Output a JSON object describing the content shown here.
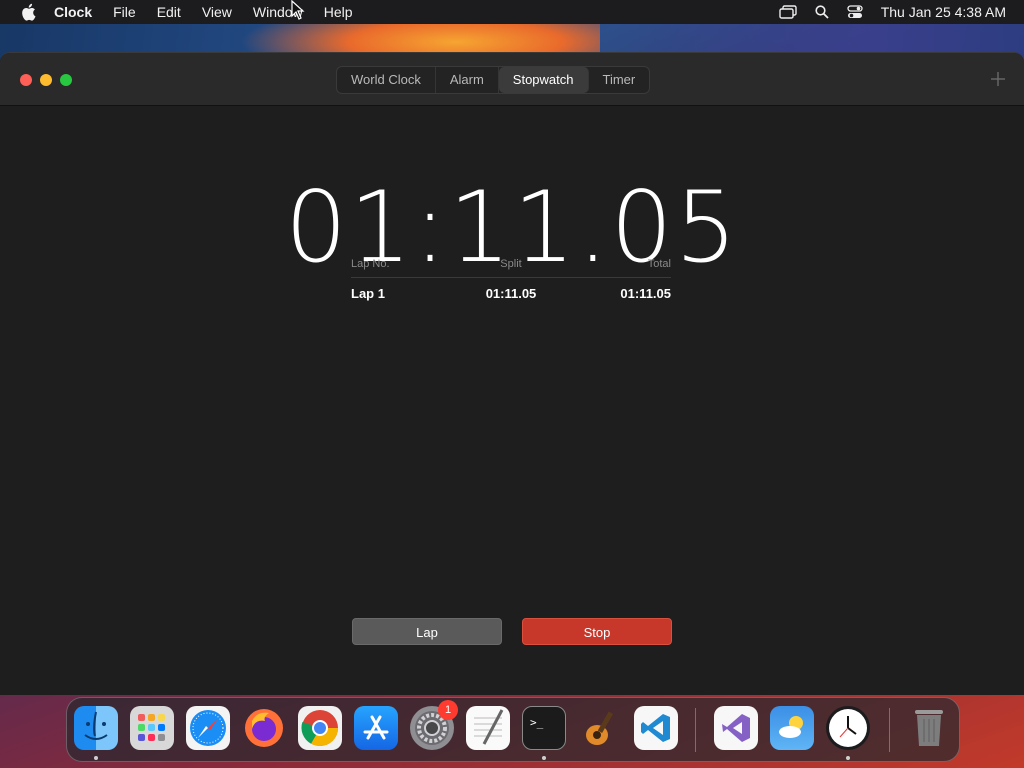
{
  "menubar": {
    "app_name": "Clock",
    "items": [
      "File",
      "Edit",
      "View",
      "Window",
      "Help"
    ],
    "datetime": "Thu Jan 25  4:38 AM"
  },
  "window": {
    "tabs": [
      {
        "label": "World Clock",
        "active": false
      },
      {
        "label": "Alarm",
        "active": false
      },
      {
        "label": "Stopwatch",
        "active": true
      },
      {
        "label": "Timer",
        "active": false
      }
    ]
  },
  "stopwatch": {
    "display": "01:11.05",
    "laps_header": {
      "lap_no": "Lap No.",
      "split": "Split",
      "total": "Total"
    },
    "laps": [
      {
        "lap": "Lap 1",
        "split": "01:11.05",
        "total": "01:11.05"
      }
    ],
    "lap_button": "Lap",
    "stop_button": "Stop"
  },
  "dock": {
    "apps": [
      "Finder",
      "Launchpad",
      "Safari",
      "Firefox",
      "Chrome",
      "App Store",
      "System Settings",
      "TextEdit",
      "Terminal",
      "GarageBand",
      "Visual Studio Code",
      "Visual Studio",
      "Weather",
      "Clock",
      "Trash"
    ],
    "system_settings_badge": "1"
  },
  "colors": {
    "stop_button": "#c8382a",
    "lap_button": "#5a5a5a",
    "window_bg": "#1e1e1e"
  }
}
